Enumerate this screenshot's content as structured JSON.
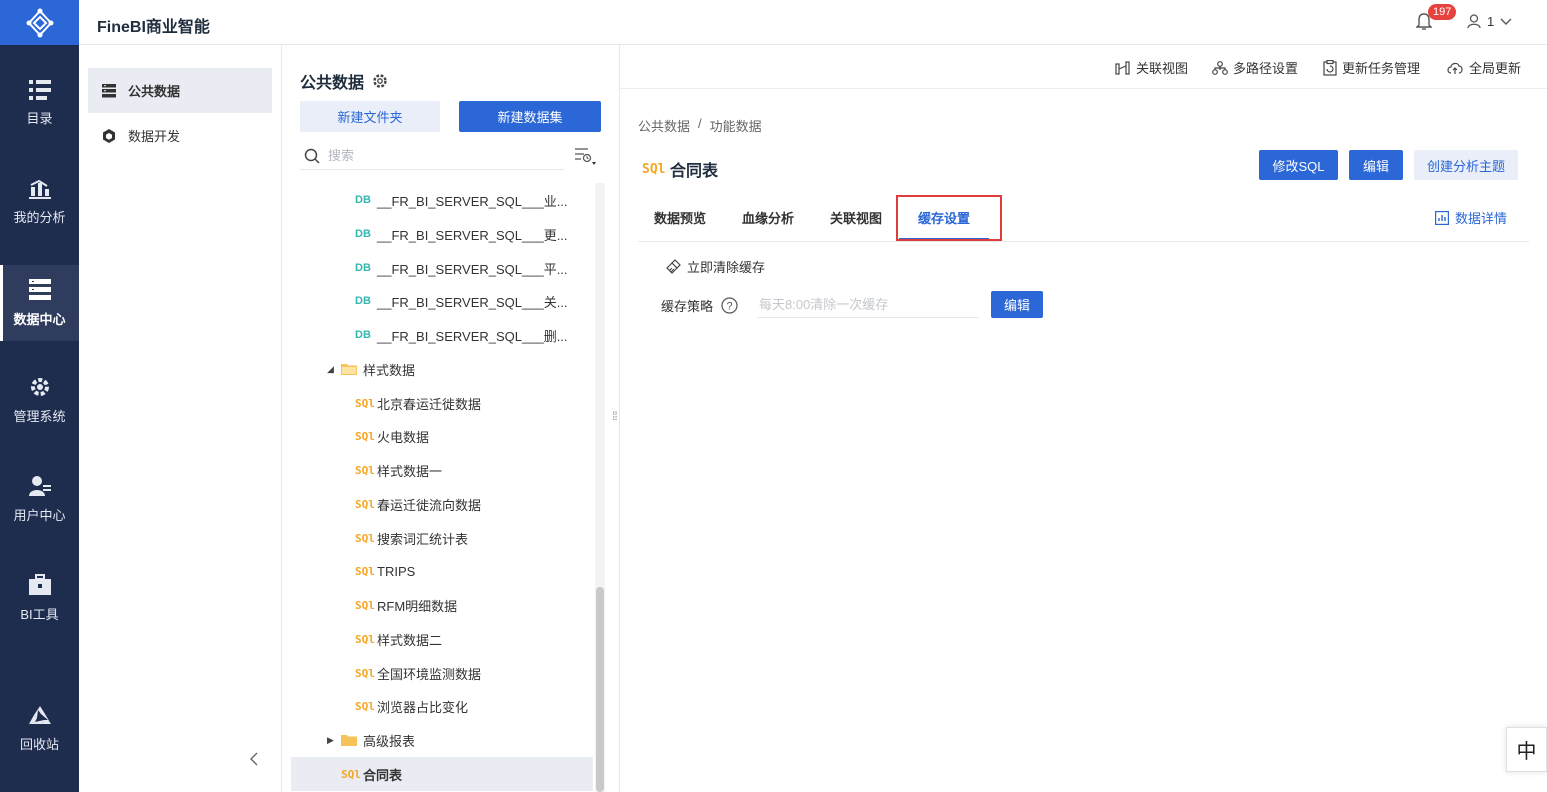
{
  "app": {
    "title": "FineBI商业智能"
  },
  "header": {
    "notification_count": "197",
    "user_label": "1"
  },
  "nav": [
    {
      "label": "目录",
      "icon": "catalog-icon"
    },
    {
      "label": "我的分析",
      "icon": "analysis-icon"
    },
    {
      "label": "数据中心",
      "icon": "data-center-icon",
      "active": true
    },
    {
      "label": "管理系统",
      "icon": "gear-icon"
    },
    {
      "label": "用户中心",
      "icon": "user-center-icon"
    },
    {
      "label": "BI工具",
      "icon": "toolbox-icon"
    },
    {
      "label": "回收站",
      "icon": "recycle-icon"
    }
  ],
  "panel2": {
    "items": [
      "公共数据",
      "数据开发"
    ]
  },
  "panel3": {
    "title": "公共数据",
    "new_folder": "新建文件夹",
    "new_dataset": "新建数据集",
    "search_placeholder": "搜索",
    "tree": [
      {
        "label": "__FR_BI_SERVER_SQL___业...",
        "type": "db"
      },
      {
        "label": "__FR_BI_SERVER_SQL___更...",
        "type": "db"
      },
      {
        "label": "__FR_BI_SERVER_SQL___平...",
        "type": "db"
      },
      {
        "label": "__FR_BI_SERVER_SQL___关...",
        "type": "db"
      },
      {
        "label": "__FR_BI_SERVER_SQL___删...",
        "type": "db"
      },
      {
        "label": "样式数据",
        "type": "folder-open"
      },
      {
        "label": "北京春运迁徙数据",
        "type": "sql"
      },
      {
        "label": "火电数据",
        "type": "sql"
      },
      {
        "label": "样式数据一",
        "type": "sql"
      },
      {
        "label": "春运迁徙流向数据",
        "type": "sql"
      },
      {
        "label": "搜索词汇统计表",
        "type": "sql"
      },
      {
        "label": "TRIPS",
        "type": "sql"
      },
      {
        "label": "RFM明细数据",
        "type": "sql"
      },
      {
        "label": "样式数据二",
        "type": "sql"
      },
      {
        "label": "全国环境监测数据",
        "type": "sql"
      },
      {
        "label": "浏览器占比变化",
        "type": "sql"
      },
      {
        "label": "高级报表",
        "type": "folder-closed"
      },
      {
        "label": "合同表",
        "type": "sql",
        "active": true
      }
    ]
  },
  "main": {
    "toolbar": [
      "关联视图",
      "多路径设置",
      "更新任务管理",
      "全局更新"
    ],
    "breadcrumb": [
      "公共数据",
      "/",
      "功能数据"
    ],
    "dataset_title": "合同表",
    "actions": [
      "修改SQL",
      "编辑",
      "创建分析主题"
    ],
    "tabs": [
      "数据预览",
      "血缘分析",
      "关联视图",
      "缓存设置"
    ],
    "data_detail": "数据详情",
    "clear_cache": "立即清除缓存",
    "cache_label": "缓存策略",
    "cache_placeholder": "每天8:00清除一次缓存",
    "cache_edit": "编辑"
  },
  "ime": "中",
  "colors": {
    "nav_bg": "#1e2c4e",
    "primary": "#2b67d6",
    "highlight": "#e03b3b",
    "sql_tag": "#f5a623",
    "db_tag": "#35b5b0"
  }
}
